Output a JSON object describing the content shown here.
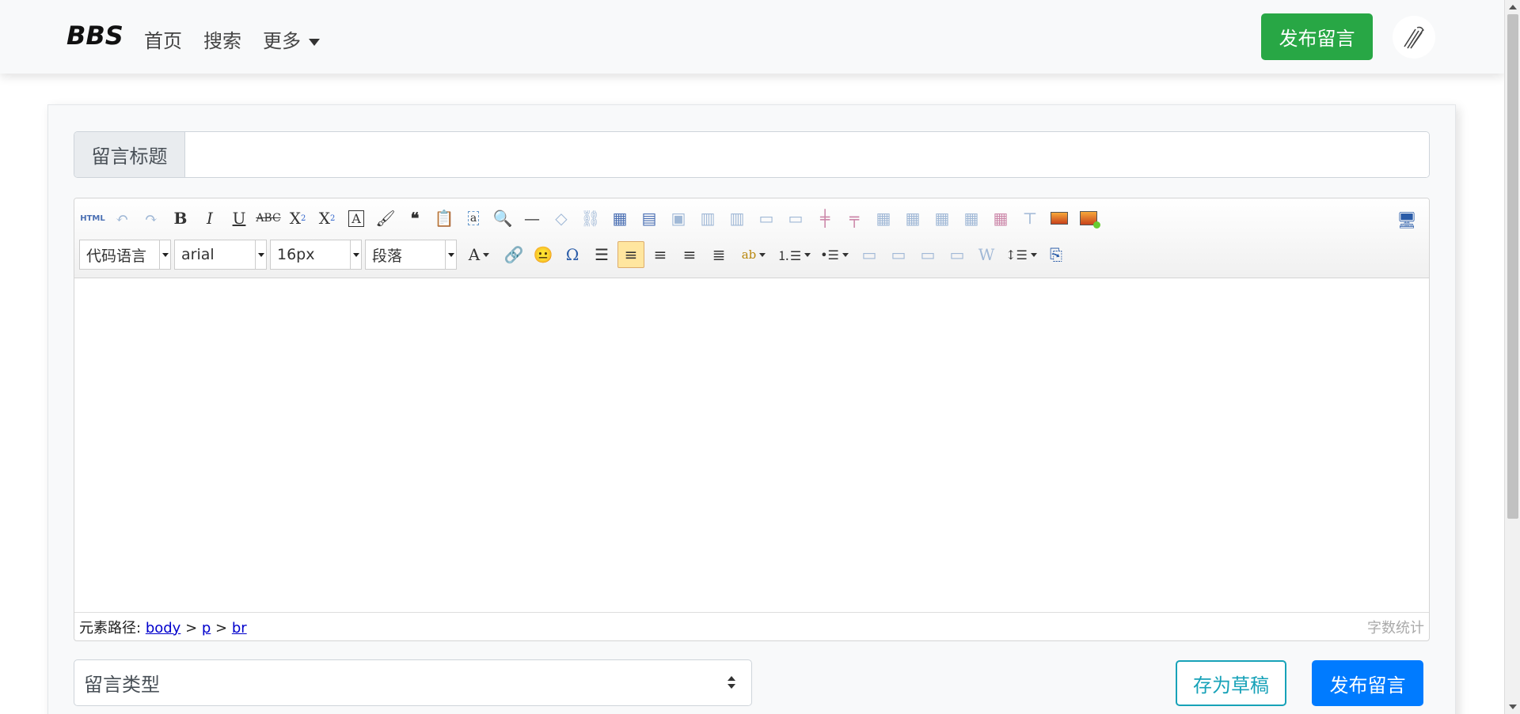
{
  "navbar": {
    "brand": "BBS",
    "links": [
      "首页",
      "搜索",
      "更多"
    ],
    "publish_button": "发布留言"
  },
  "form": {
    "title_prefix": "留言标题",
    "title_value": "",
    "type_select": "留言类型",
    "draft_button": "存为草稿",
    "publish_button": "发布留言"
  },
  "editor": {
    "toolbar_row1": [
      "html-source-icon",
      "undo-icon",
      "redo-icon",
      "bold-icon",
      "italic-icon",
      "underline-icon",
      "strikethrough-icon",
      "subscript-icon",
      "superscript-icon",
      "format-match-icon",
      "clear-format-icon",
      "blockquote-icon",
      "paste-plain-icon",
      "select-all-icon",
      "search-replace-icon",
      "horizontal-rule-icon",
      "eraser-icon",
      "unlink-icon",
      "insert-table-icon",
      "table-properties-icon",
      "delete-table-icon",
      "insert-row-icon",
      "insert-col-icon",
      "merge-cells-icon",
      "split-cells-icon",
      "delete-row-icon",
      "delete-col-icon",
      "table-row-icon",
      "table-col-icon",
      "table-merge-icon",
      "table-split-icon",
      "table-title-icon",
      "insert-image-icon",
      "insert-multiimage-icon"
    ],
    "combos": {
      "code_language": "代码语言",
      "font_family": "arial",
      "font_size": "16px",
      "paragraph": "段落"
    },
    "status_path_label": "元素路径:",
    "status_path": [
      "body",
      "p",
      "br"
    ],
    "word_count_label": "字数统计"
  },
  "colors": {
    "success": "#28a745",
    "primary": "#007bff",
    "info": "#17a2b8",
    "active_tool": "#ffe69f"
  }
}
